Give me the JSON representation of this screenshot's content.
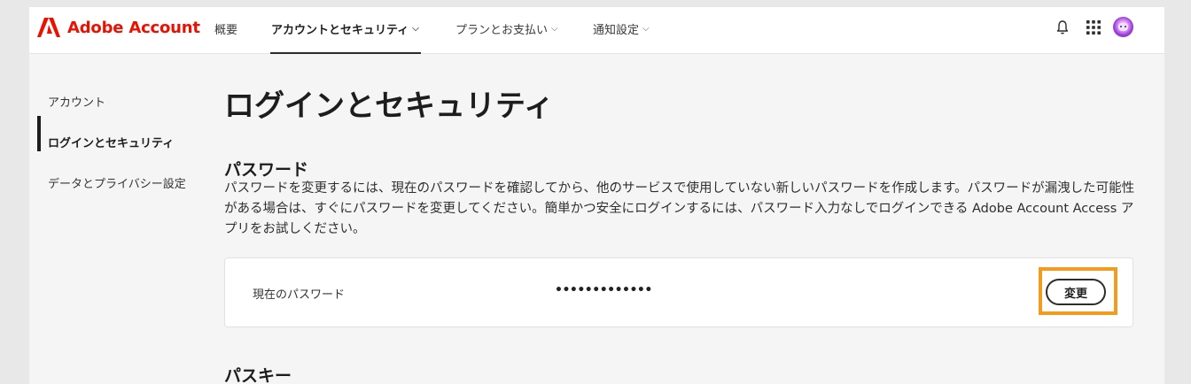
{
  "header": {
    "brand": "Adobe Account",
    "nav": [
      {
        "label": "概要",
        "chevron": false
      },
      {
        "label": "アカウントとセキュリティ",
        "chevron": true
      },
      {
        "label": "プランとお支払い",
        "chevron": true
      },
      {
        "label": "通知設定",
        "chevron": true
      }
    ],
    "chevron_glyph": "⌵",
    "icons": [
      "bell-icon",
      "app-grid-icon",
      "avatar"
    ]
  },
  "sidebar": {
    "items": [
      {
        "label": "アカウント"
      },
      {
        "label": "ログインとセキュリティ"
      },
      {
        "label": "データとプライバシー設定"
      }
    ]
  },
  "main": {
    "page_title": "ログインとセキュリティ",
    "password": {
      "title": "パスワード",
      "description": "パスワードを変更するには、現在のパスワードを確認してから、他のサービスで使用していない新しいパスワードを作成します。パスワードが漏洩した可能性がある場合は、すぐにパスワードを変更してください。簡単かつ安全にログインするには、パスワード入力なしでログインできる Adobe Account Access アプリをお試しください。",
      "current_label": "現在のパスワード",
      "current_value": "•••••••••••••",
      "change_button": "変更"
    },
    "passkey": {
      "title": "パスキー"
    }
  },
  "colors": {
    "brand_red": "#eb1000",
    "highlight_orange": "#f29b1f"
  }
}
